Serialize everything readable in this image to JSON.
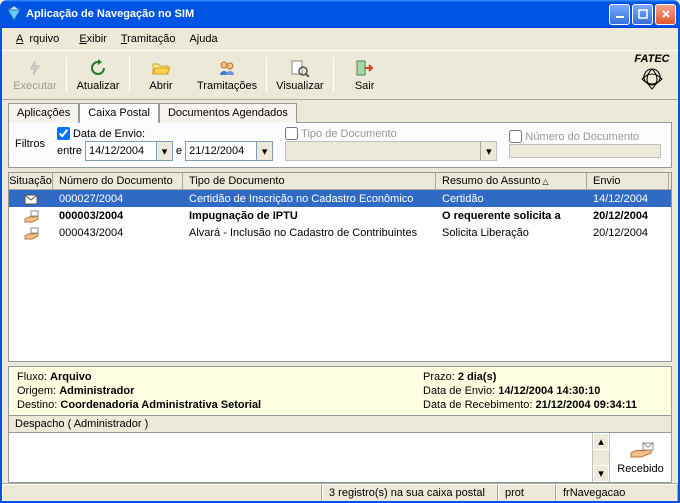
{
  "window": {
    "title": "Aplicação de Navegação no SIM"
  },
  "menu": {
    "arquivo": "Arquivo",
    "exibir": "Exibir",
    "tramitacao": "Tramitação",
    "ajuda": "Ajuda"
  },
  "toolbar": {
    "executar": "Executar",
    "atualizar": "Atualizar",
    "abrir": "Abrir",
    "tramitacoes": "Tramitações",
    "visualizar": "Visualizar",
    "sair": "Sair"
  },
  "logo": "FATEC",
  "tabs": {
    "aplicacoes": "Aplicações",
    "caixa": "Caixa Postal",
    "agendados": "Documentos Agendados"
  },
  "filters": {
    "label": "Filtros",
    "data_envio_chk": "Data de Envio:",
    "entre": "entre",
    "e": "e",
    "d1": "14/12/2004",
    "d2": "21/12/2004",
    "tipo_lbl": "Tipo de Documento",
    "num_lbl": "Número do Documento"
  },
  "grid": {
    "h0": "Situação",
    "h1": "Número do Documento",
    "h2": "Tipo de Documento",
    "h3": "Resumo do Assunto",
    "h4": "Envio",
    "rows": [
      {
        "num": "000027/2004",
        "tipo": "Certidão de Inscrição no Cadastro Econômico",
        "res": "Certidão",
        "env": "14/12/2004",
        "sel": true,
        "bold": false
      },
      {
        "num": "000003/2004",
        "tipo": "Impugnação de IPTU",
        "res": "O requerente solicita a",
        "env": "20/12/2004",
        "sel": false,
        "bold": true
      },
      {
        "num": "000043/2004",
        "tipo": "Alvará - Inclusão no Cadastro de Contribuintes",
        "res": "Solicita Liberação",
        "env": "20/12/2004",
        "sel": false,
        "bold": false
      }
    ]
  },
  "details": {
    "fluxo_lbl": "Fluxo:",
    "fluxo": "Arquivo",
    "origem_lbl": "Origem:",
    "origem": "Administrador",
    "destino_lbl": "Destino:",
    "destino": "Coordenadoria Administrativa Setorial",
    "prazo_lbl": "Prazo:",
    "prazo": "2 dia(s)",
    "envio_lbl": "Data de Envio:",
    "envio": "14/12/2004  14:30:10",
    "receb_lbl": "Data de Recebimento:",
    "receb": "21/12/2004  09:34:11"
  },
  "despacho": "Despacho ( Administrador )",
  "recebido": "Recebido",
  "status": {
    "s2": "3 registro(s) na sua caixa postal",
    "s3": "prot",
    "s4": "frNavegacao"
  }
}
